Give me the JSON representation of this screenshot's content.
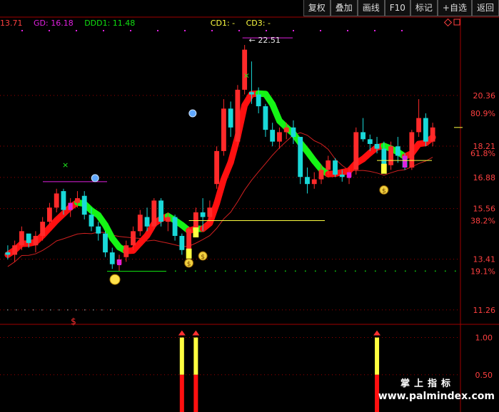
{
  "toolbar": {
    "buttons": [
      "复权",
      "叠加",
      "画线",
      "F10",
      "标记",
      "+自选",
      "返回"
    ]
  },
  "legend": {
    "first_value": "13.71",
    "gd": "GD: 16.18",
    "ddd1": "DDD1: 11.48",
    "cd1": "CD1: -",
    "cd3": "CD3: -"
  },
  "colors": {
    "up": "#ff2a2a",
    "down": "#19d9d9",
    "ma_up": "#ff1010",
    "ma_down": "#15f515",
    "gd": "#e020e0",
    "ddd1": "#10e010",
    "cd": "#ffff40",
    "price_axis": "#ff4040",
    "pct_axis": "#ff4040",
    "sub_axis": "#ff4040"
  },
  "chart_data": {
    "type": "candlestick",
    "price_axis_ticks": [
      "20.36",
      "18.21",
      "16.88",
      "15.56",
      "13.41",
      "11.26"
    ],
    "pct_axis_ticks": [
      "80.9%",
      "61.8%",
      "38.2%",
      "19.1%"
    ],
    "annotation_high": "22.51",
    "ylim": [
      10.8,
      23.5
    ],
    "candles": [
      [
        13.7,
        14.0,
        13.4,
        13.6
      ],
      [
        13.6,
        14.2,
        13.3,
        14.0
      ],
      [
        14.0,
        14.8,
        13.8,
        14.6
      ],
      [
        14.5,
        14.4,
        13.9,
        14.1
      ],
      [
        14.0,
        14.6,
        13.7,
        14.4
      ],
      [
        14.4,
        15.2,
        14.2,
        15.0
      ],
      [
        15.0,
        15.8,
        14.9,
        15.6
      ],
      [
        15.6,
        16.4,
        15.4,
        16.2
      ],
      [
        16.3,
        16.4,
        15.3,
        15.5
      ],
      [
        15.5,
        16.0,
        15.2,
        15.8
      ],
      [
        15.8,
        16.3,
        15.6,
        16.0
      ],
      [
        16.1,
        16.3,
        15.1,
        15.3
      ],
      [
        15.3,
        15.6,
        14.6,
        14.8
      ],
      [
        14.8,
        15.0,
        14.2,
        14.5
      ],
      [
        14.5,
        14.6,
        13.5,
        13.7
      ],
      [
        13.7,
        13.9,
        13.0,
        13.2
      ],
      [
        13.2,
        13.6,
        12.9,
        13.4
      ],
      [
        13.5,
        14.2,
        13.3,
        14.0
      ],
      [
        14.0,
        14.8,
        13.8,
        14.6
      ],
      [
        14.6,
        15.5,
        14.4,
        15.3
      ],
      [
        15.2,
        15.6,
        14.6,
        14.8
      ],
      [
        14.8,
        16.0,
        14.7,
        15.9
      ],
      [
        15.9,
        16.0,
        14.8,
        15.0
      ],
      [
        15.0,
        15.4,
        14.6,
        15.2
      ],
      [
        15.2,
        15.3,
        14.2,
        14.4
      ],
      [
        14.4,
        14.5,
        13.6,
        13.8
      ],
      [
        13.8,
        14.8,
        13.7,
        14.7
      ],
      [
        14.7,
        15.6,
        14.5,
        15.4
      ],
      [
        15.4,
        16.0,
        14.6,
        15.2
      ],
      [
        15.2,
        15.9,
        15.0,
        15.6
      ],
      [
        16.6,
        18.2,
        16.4,
        18.0
      ],
      [
        18.0,
        20.2,
        17.8,
        19.8
      ],
      [
        19.8,
        20.1,
        18.6,
        19.0
      ],
      [
        18.4,
        20.8,
        18.2,
        20.6
      ],
      [
        20.6,
        22.5,
        20.4,
        22.3
      ],
      [
        20.5,
        21.8,
        20.0,
        20.4
      ],
      [
        20.4,
        20.7,
        19.6,
        19.9
      ],
      [
        19.9,
        20.0,
        18.6,
        18.9
      ],
      [
        18.9,
        19.2,
        18.2,
        18.4
      ],
      [
        18.4,
        19.0,
        18.1,
        18.8
      ],
      [
        18.8,
        19.2,
        18.5,
        19.0
      ],
      [
        19.0,
        19.3,
        18.3,
        18.6
      ],
      [
        18.6,
        18.6,
        16.6,
        16.9
      ],
      [
        16.9,
        17.3,
        16.2,
        16.6
      ],
      [
        16.6,
        17.1,
        16.4,
        16.8
      ],
      [
        16.8,
        17.4,
        16.6,
        17.2
      ],
      [
        17.2,
        17.8,
        17.0,
        17.6
      ],
      [
        17.6,
        17.7,
        16.9,
        17.0
      ],
      [
        17.0,
        17.2,
        16.7,
        16.9
      ],
      [
        16.9,
        17.3,
        16.6,
        17.1
      ],
      [
        17.2,
        19.0,
        17.0,
        18.8
      ],
      [
        18.8,
        19.4,
        18.4,
        18.5
      ],
      [
        18.5,
        18.7,
        18.0,
        18.3
      ],
      [
        18.3,
        18.6,
        17.9,
        18.1
      ],
      [
        18.1,
        18.4,
        17.2,
        17.4
      ],
      [
        17.4,
        18.4,
        17.2,
        18.2
      ],
      [
        18.2,
        18.6,
        17.5,
        17.8
      ],
      [
        17.8,
        17.9,
        17.2,
        17.3
      ],
      [
        17.3,
        18.9,
        17.2,
        18.8
      ],
      [
        18.8,
        20.2,
        18.6,
        19.4
      ],
      [
        19.4,
        19.6,
        18.2,
        18.4
      ],
      [
        18.4,
        19.2,
        18.2,
        19.0
      ]
    ],
    "signal_boxes_yellow": [
      26,
      27,
      54
    ],
    "signal_boxes_magenta": [
      9,
      16,
      49,
      57
    ],
    "sub_axis_ticks": [
      "1.00",
      "0.50"
    ],
    "sub_signals": [
      25,
      27,
      53
    ]
  },
  "watermark": {
    "cn": "掌上指标",
    "url": "www.palmindex.com"
  }
}
